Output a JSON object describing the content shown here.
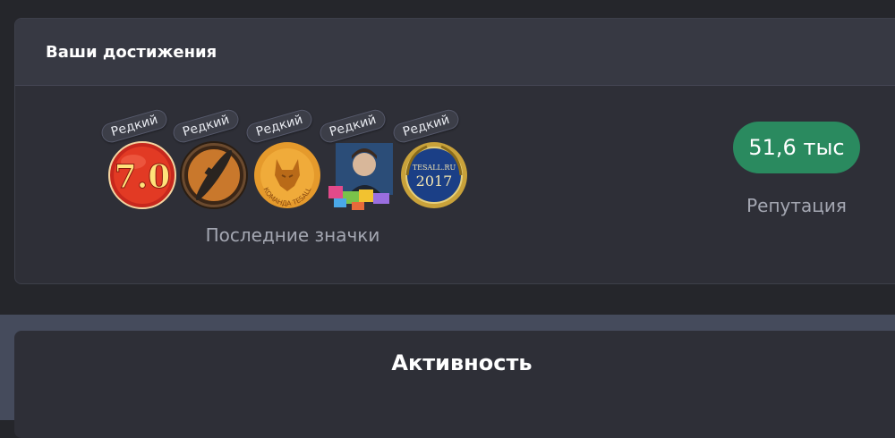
{
  "achievements": {
    "title": "Ваши достижения",
    "badges": [
      {
        "icon": "version-7-medal-icon",
        "tag": "Редкий",
        "text": "7.0"
      },
      {
        "icon": "submarine-badge-icon",
        "tag": "Редкий"
      },
      {
        "icon": "wolf-team-tesall-badge-icon",
        "tag": "Редкий",
        "text": "КОМАНДА TESALL"
      },
      {
        "icon": "portrait-with-gifts-badge-icon",
        "tag": "Редкий"
      },
      {
        "icon": "tesall-2017-laurel-badge-icon",
        "tag": "Редкий",
        "text": "TESALL.RU",
        "year": "2017"
      }
    ],
    "badges_caption": "Последние значки",
    "reputation_value": "51,6 тыс",
    "reputation_label": "Репутация",
    "colors": {
      "reputation_pill": "#2a8a5f"
    }
  },
  "activity": {
    "title": "Активность"
  }
}
